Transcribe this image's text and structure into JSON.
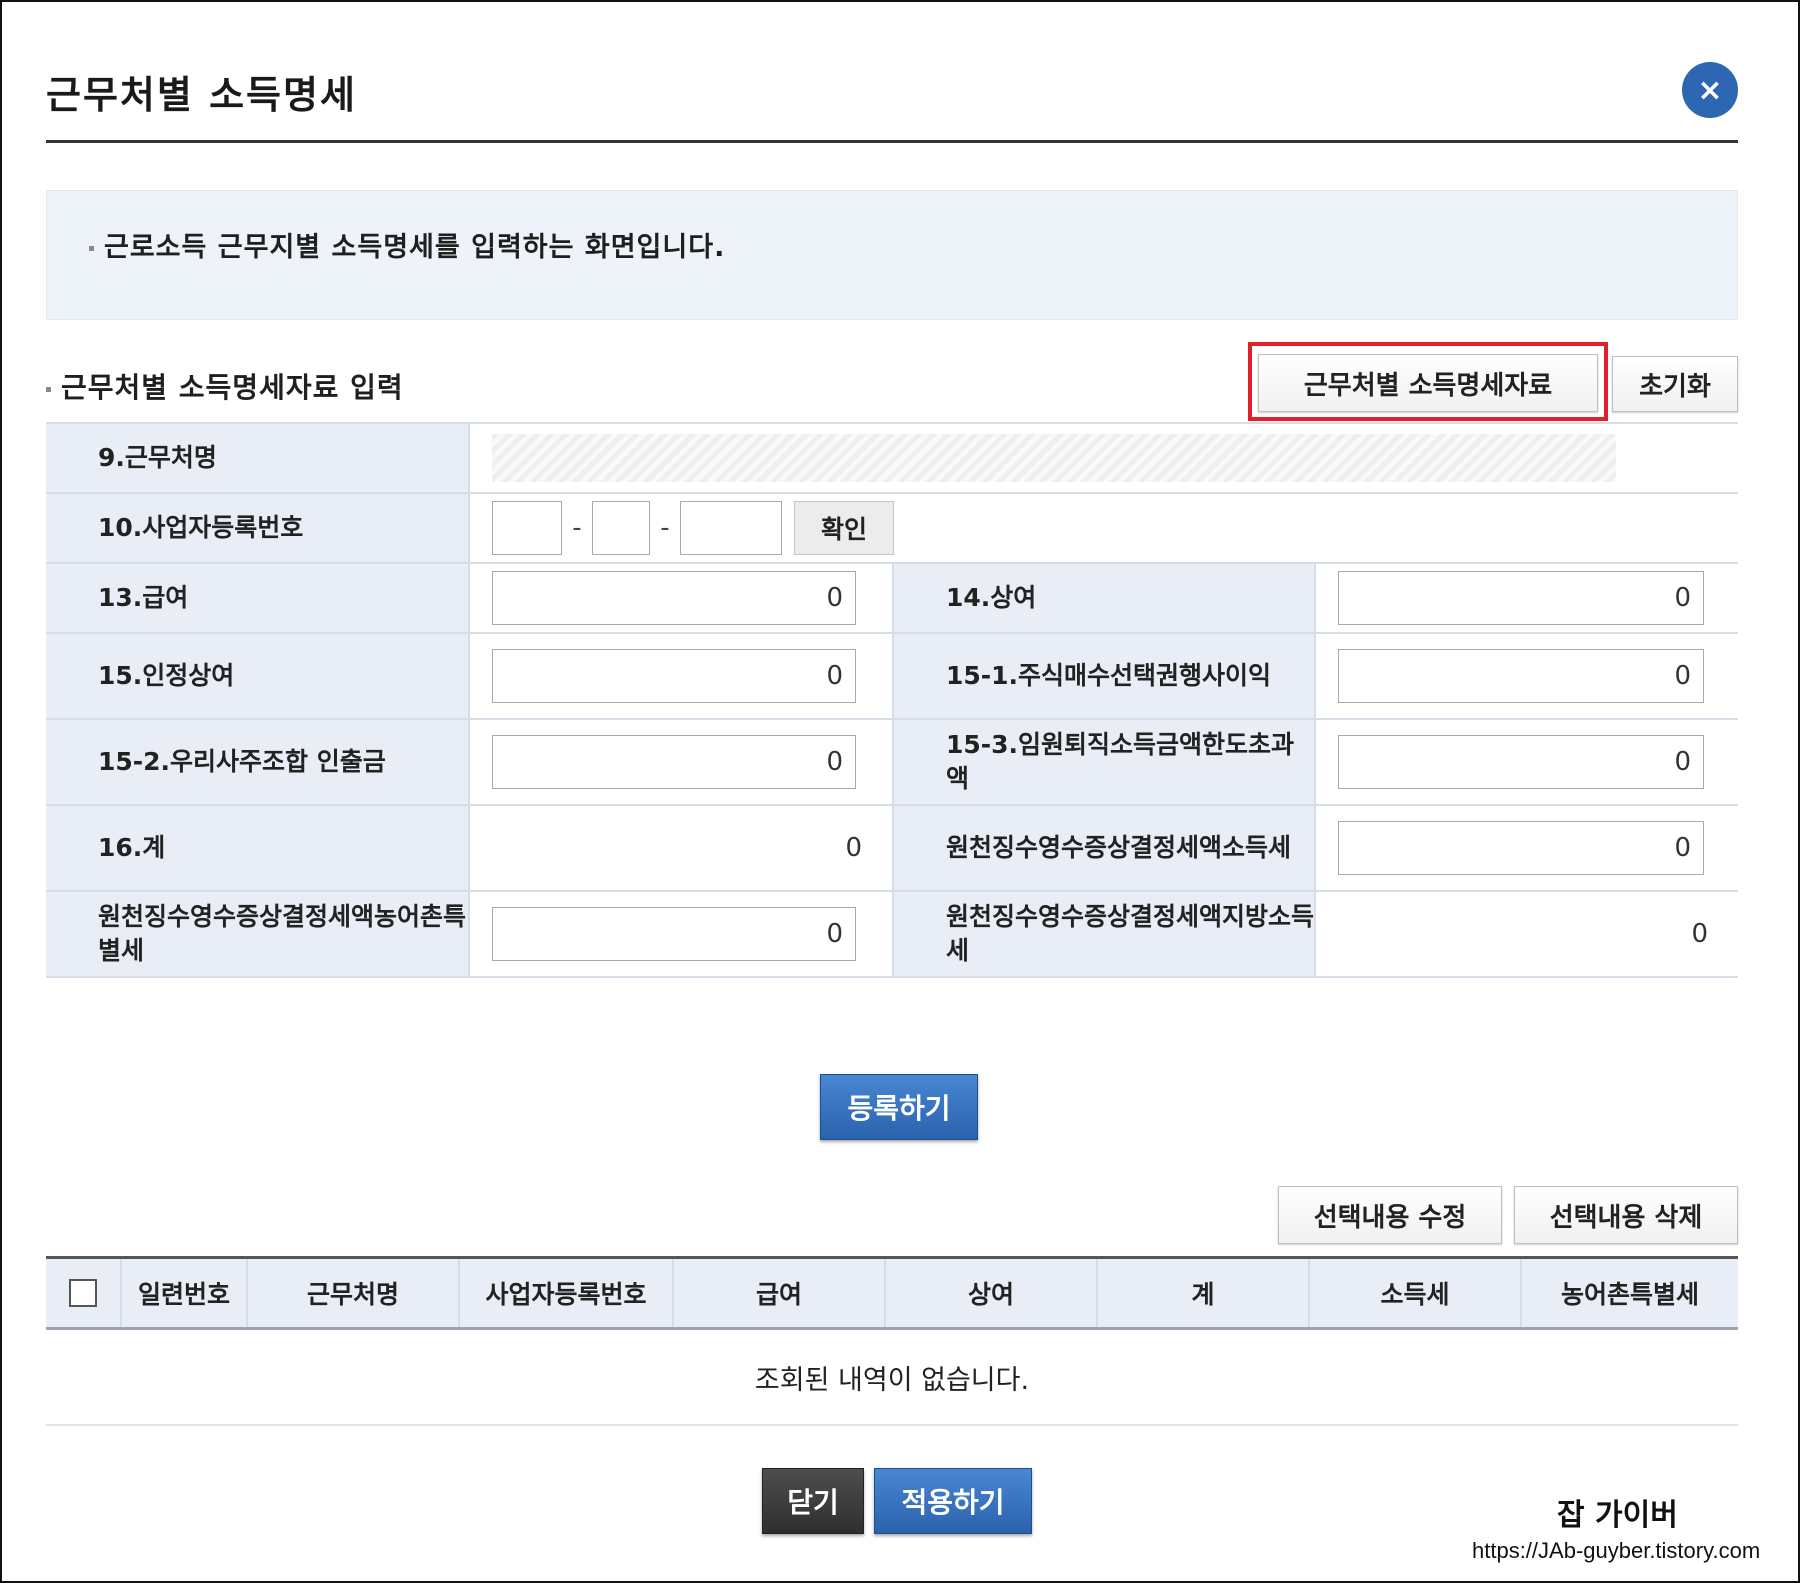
{
  "dialog": {
    "title": "근무처별 소득명세",
    "close_label": "×",
    "info_text": "근로소득 근무지별 소득명세를 입력하는 화면입니다."
  },
  "section": {
    "title": "근무처별 소득명세자료 입력",
    "data_button": "근무처별 소득명세자료",
    "reset_button": "초기화"
  },
  "form": {
    "workplace_label": "9.근무처명",
    "biz_no_label": "10.사업자등록번호",
    "biz_dash": "-",
    "confirm_button": "확인",
    "salary_label": "13.급여",
    "salary_value": "0",
    "bonus_label": "14.상여",
    "bonus_value": "0",
    "recognized_bonus_label": "15.인정상여",
    "recognized_bonus_value": "0",
    "stock_option_label": "15-1.주식매수선택권행사이익",
    "stock_option_value": "0",
    "esop_label": "15-2.우리사주조합 인출금",
    "esop_value": "0",
    "executive_label": "15-3.임원퇴직소득금액한도초과액",
    "executive_value": "0",
    "total_label": "16.계",
    "total_value": "0",
    "wh_income_tax_label": "원천징수영수증상결정세액소득세",
    "wh_income_tax_value": "0",
    "wh_rural_tax_label": "원천징수영수증상결정세액농어촌특별세",
    "wh_rural_tax_value": "0",
    "wh_local_tax_label": "원천징수영수증상결정세액지방소득세",
    "wh_local_tax_value": "0"
  },
  "actions": {
    "register_button": "등록하기",
    "edit_selected": "선택내용 수정",
    "delete_selected": "선택내용 삭제",
    "close_button": "닫기",
    "apply_button": "적용하기"
  },
  "list": {
    "columns": [
      "일련번호",
      "근무처명",
      "사업자등록번호",
      "급여",
      "상여",
      "계",
      "소득세",
      "농어촌특별세"
    ],
    "empty_message": "조회된 내역이 없습니다."
  },
  "watermark": {
    "name": "잡 가이버",
    "url": "https://JAb-guyber.tistory.com"
  },
  "colors": {
    "accent_blue": "#2d66b3",
    "highlight_red": "#e0202a",
    "label_bg": "#e9eef6",
    "info_bg": "#eef3fa"
  }
}
